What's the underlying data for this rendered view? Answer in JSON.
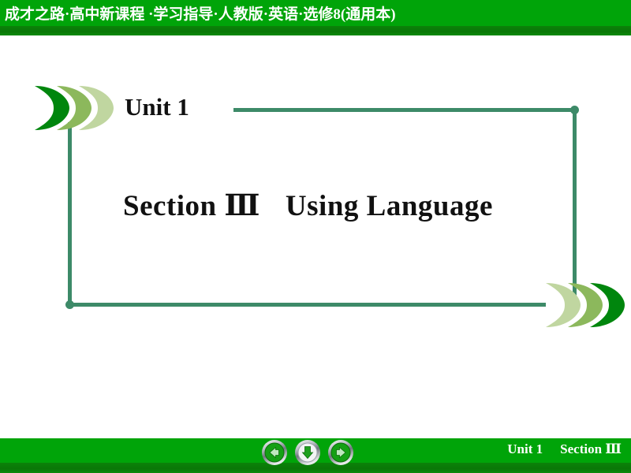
{
  "header": {
    "title": "成才之路·高中新课程 ·学习指导·人教版·英语·选修8(通用本)",
    "band_color": "#00a409",
    "shadow_color": "#0a7707",
    "text_color": "#ffffff"
  },
  "slide": {
    "unit_label": "Unit 1",
    "section_label": "Section Ⅲ",
    "section_topic": "Using Language",
    "frame_line_color": "#3d8a68",
    "text_color": "#111111",
    "decor": {
      "top_left_icon": "triple-chevron-right-icon",
      "bottom_right_icon": "triple-chevron-right-icon",
      "chevron_colors_top_left": [
        "#00860d",
        "#8cb85c",
        "#c0d6a0"
      ],
      "chevron_colors_bottom_right": [
        "#c0d6a0",
        "#8cb85c",
        "#00860d"
      ]
    }
  },
  "footer": {
    "unit_label": "Unit 1",
    "section_label": "Section Ⅲ",
    "band_color": "#00a409",
    "text_color": "#ffffff",
    "nav": {
      "prev": {
        "name": "previous-slide-button",
        "icon": "arrow-left-icon",
        "label": "←"
      },
      "down": {
        "name": "next-step-button",
        "icon": "arrow-down-icon",
        "label": "↓"
      },
      "next": {
        "name": "next-slide-button",
        "icon": "arrow-right-icon",
        "label": "→"
      },
      "arrow_color": "#1ea01e",
      "bezel_color": "#c9ccd0"
    }
  }
}
